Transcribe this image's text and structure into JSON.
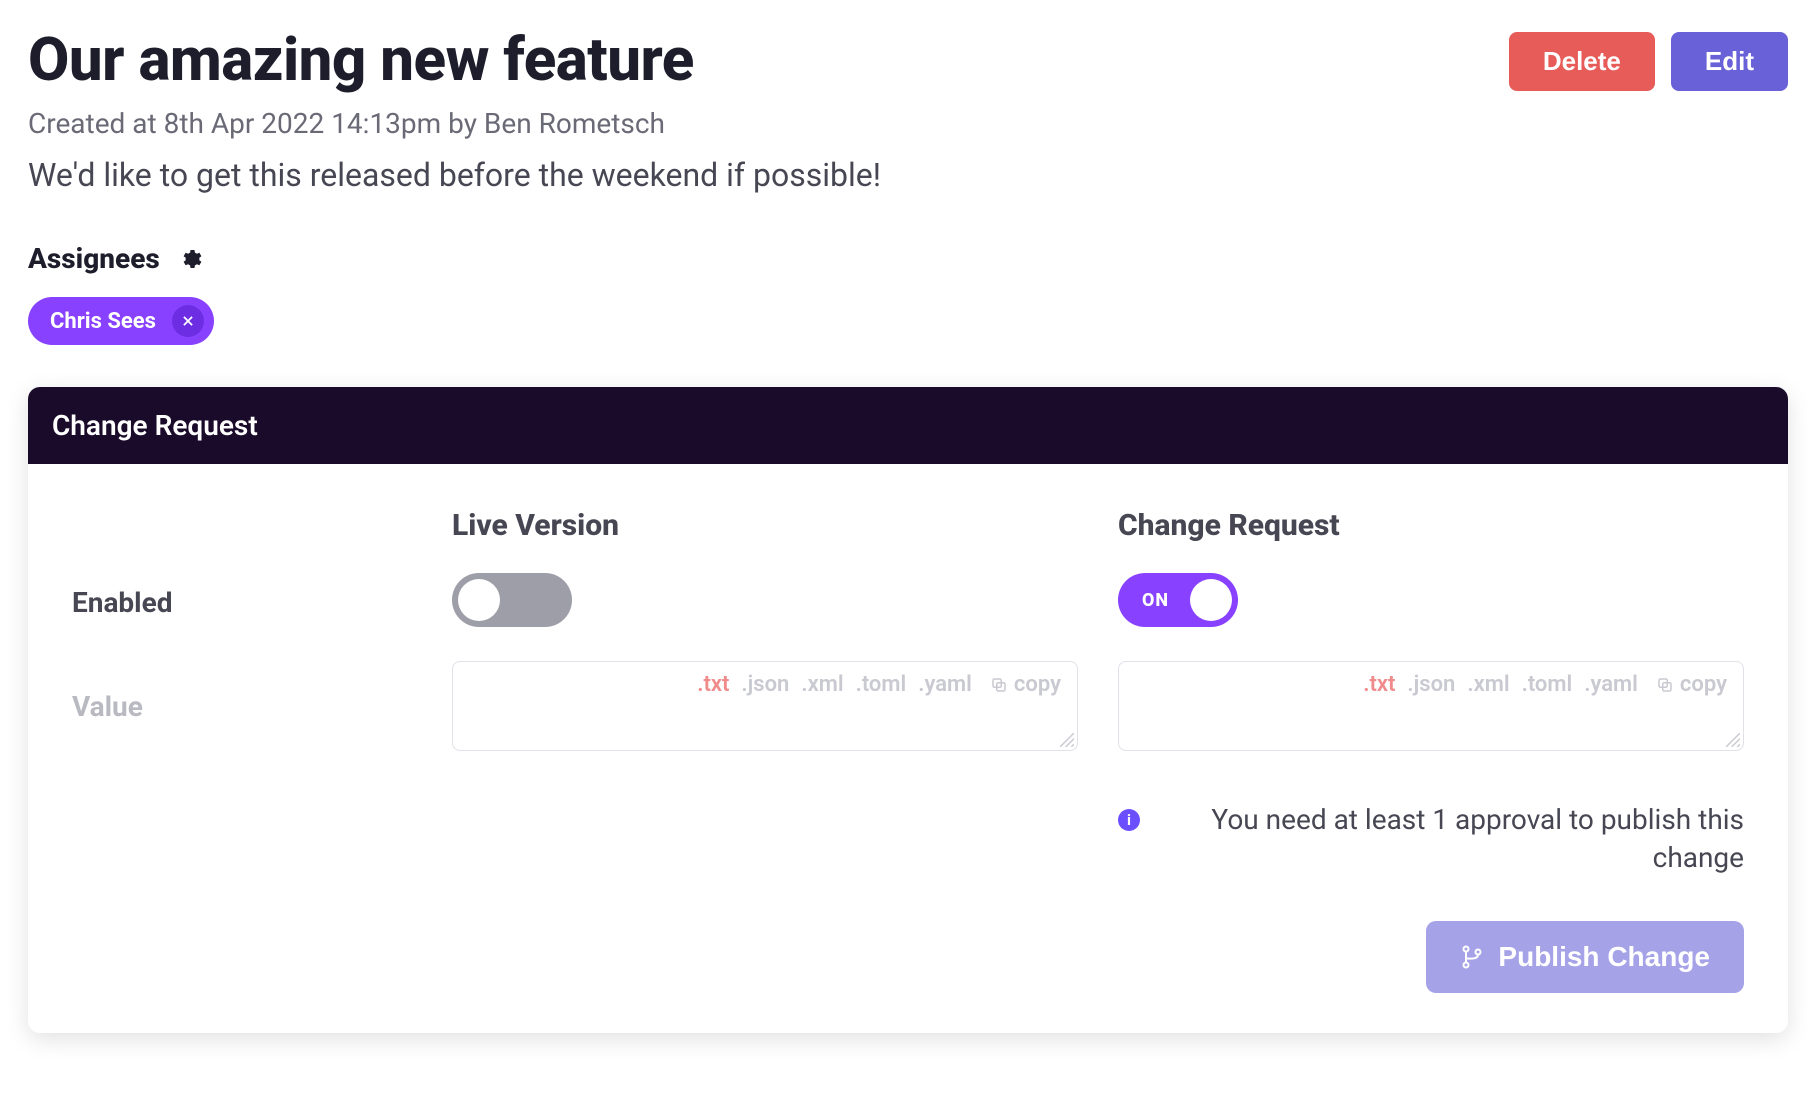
{
  "header": {
    "title": "Our amazing new feature",
    "meta": "Created at 8th Apr 2022 14:13pm by Ben Rometsch",
    "description": "We'd like to get this released before the weekend if possible!",
    "delete_label": "Delete",
    "edit_label": "Edit"
  },
  "assignees": {
    "heading": "Assignees",
    "chips": [
      {
        "name": "Chris Sees"
      }
    ]
  },
  "panel": {
    "title": "Change Request",
    "columns": {
      "live": "Live Version",
      "change": "Change Request"
    },
    "rows": {
      "enabled": "Enabled",
      "value": "Value"
    },
    "toggle_on_label": "ON",
    "formats": {
      "txt": ".txt",
      "json": ".json",
      "xml": ".xml",
      "toml": ".toml",
      "yaml": ".yaml",
      "copy": "copy"
    },
    "info": "You need at least 1 approval to publish this change",
    "publish_label": "Publish Change"
  }
}
